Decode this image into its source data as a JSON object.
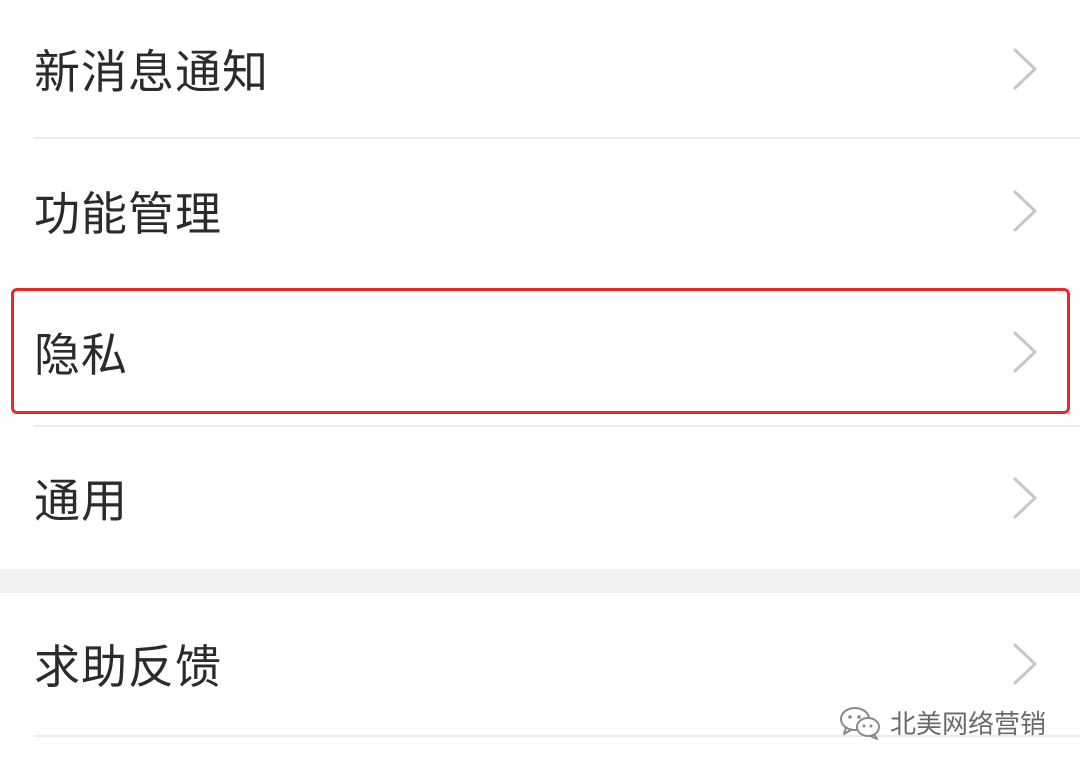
{
  "settings": {
    "items": [
      {
        "label": "新消息通知",
        "icon": "chevron-right-icon"
      },
      {
        "label": "功能管理",
        "icon": "chevron-right-icon"
      },
      {
        "label": "隐私",
        "icon": "chevron-right-icon",
        "highlighted": true
      },
      {
        "label": "通用",
        "icon": "chevron-right-icon"
      },
      {
        "label": "求助反馈",
        "icon": "chevron-right-icon"
      }
    ]
  },
  "highlight_color": "#e8282b",
  "watermark": {
    "text": "北美网络营销",
    "icon": "wechat-icon"
  }
}
